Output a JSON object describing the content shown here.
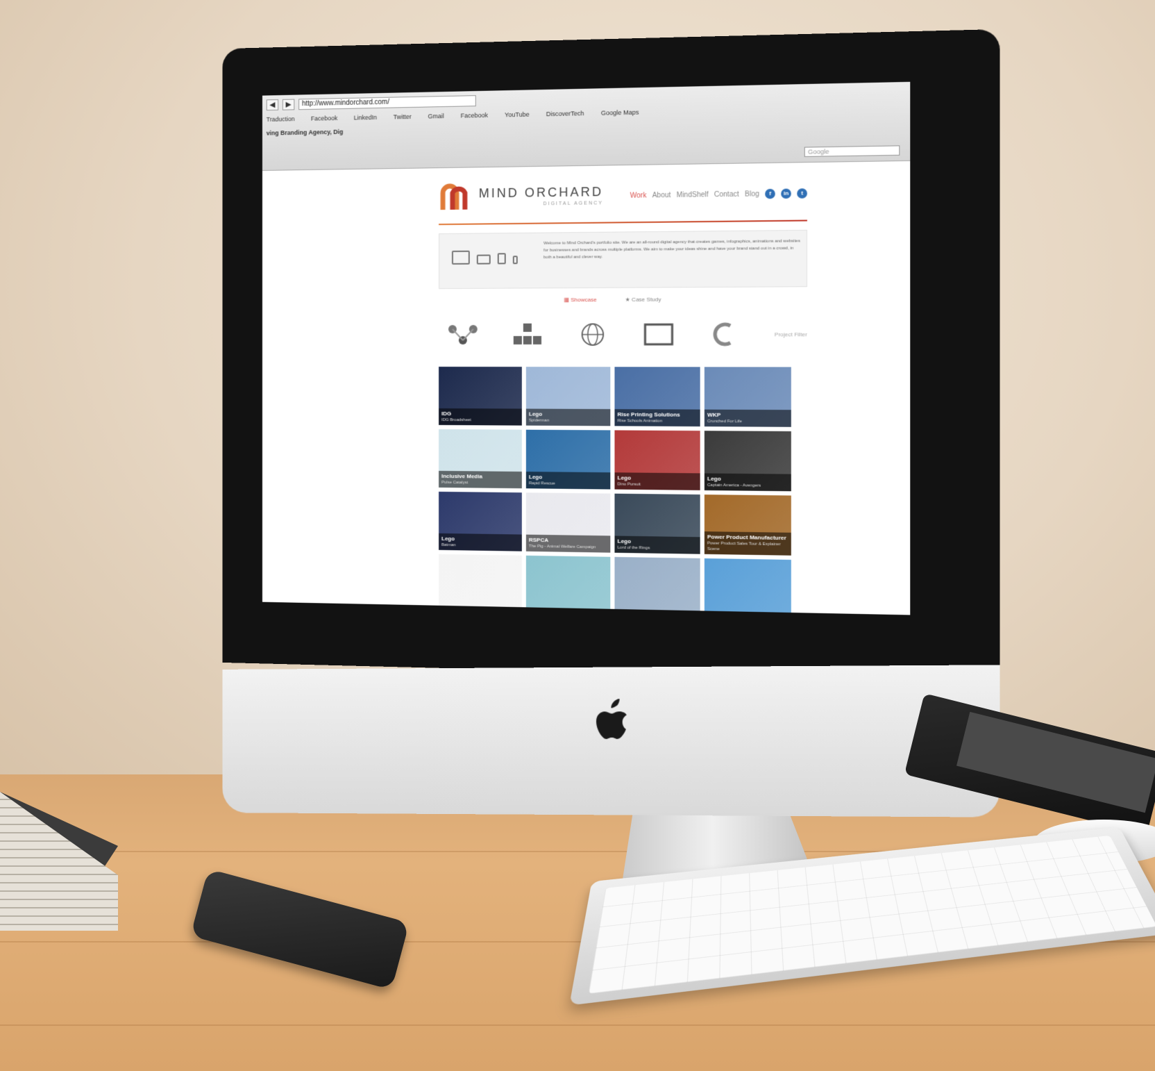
{
  "browser": {
    "back": "◀",
    "forward": "▶",
    "url": "http://www.mindorchard.com/",
    "bookmarks": [
      "Traduction",
      "Facebook",
      "LinkedIn",
      "Twitter",
      "Gmail",
      "Facebook",
      "YouTube",
      "DiscoverTech",
      "Google Maps"
    ],
    "tab_title": "ving Branding Agency, Dig",
    "search_placeholder": "Google"
  },
  "site": {
    "brand_name": "MIND ORCHARD",
    "brand_tagline": "DIGITAL AGENCY",
    "nav": [
      "Work",
      "About",
      "MindShelf",
      "Contact",
      "Blog"
    ],
    "active_nav": "Work",
    "social": [
      {
        "name": "facebook-icon",
        "glyph": "f"
      },
      {
        "name": "linkedin-icon",
        "glyph": "in"
      },
      {
        "name": "twitter-icon",
        "glyph": "t"
      }
    ],
    "intro_text": "Welcome to Mind Orchard's portfolio site. We are an all-round digital agency that creates games, infographics, animations and websites for businesses and brands across multiple platforms. We aim to make your ideas shine and have your brand stand out in a crowd, in both a beautiful and clever way.",
    "tabs": [
      {
        "label": "Showcase",
        "icon": "grid-icon"
      },
      {
        "label": "Case Study",
        "icon": "star-icon"
      }
    ],
    "filter_label": "Project Filter",
    "tiles": [
      {
        "title": "IDG",
        "subtitle": "IDG Broadsheet",
        "color": "#1d2a4d"
      },
      {
        "title": "Lego",
        "subtitle": "Spiderman",
        "color": "#9fb8d8"
      },
      {
        "title": "Rise Printing Solutions",
        "subtitle": "Rise Schools Animation",
        "color": "#4a6fa5"
      },
      {
        "title": "WKP",
        "subtitle": "Crunched For Life",
        "color": "#6b8bb8"
      },
      {
        "title": "Inclusive Media",
        "subtitle": "Pulse Catalyst",
        "color": "#cfe3ea"
      },
      {
        "title": "Lego",
        "subtitle": "Rapid Rescue",
        "color": "#2e6fa8"
      },
      {
        "title": "Lego",
        "subtitle": "Dino Pursuit",
        "color": "#b33a3a"
      },
      {
        "title": "Lego",
        "subtitle": "Captain America - Avengers",
        "color": "#3b3b3b"
      },
      {
        "title": "Lego",
        "subtitle": "Batman",
        "color": "#2d3a6b"
      },
      {
        "title": "RSPCA",
        "subtitle": "The Pig - Animal Welfare Campaign",
        "color": "#e9e9ee"
      },
      {
        "title": "Lego",
        "subtitle": "Lord of the Rings",
        "color": "#3a4a5a"
      },
      {
        "title": "Power Product Manufacturer",
        "subtitle": "Power Product Sales Tour & Explainer Scene",
        "color": "#a36a2a"
      },
      {
        "title": "",
        "subtitle": "",
        "color": "#f4f4f4"
      },
      {
        "title": "",
        "subtitle": "",
        "color": "#8cc4cf"
      },
      {
        "title": "",
        "subtitle": "",
        "color": "#9ab0c8"
      },
      {
        "title": "",
        "subtitle": "",
        "color": "#5aa0d8"
      }
    ]
  },
  "colors": {
    "accent": "#d9534f",
    "brand_orange": "#e07b39",
    "social_blue": "#2f6fb5"
  }
}
